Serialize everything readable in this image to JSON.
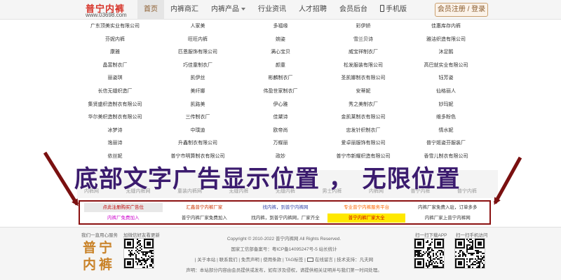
{
  "header": {
    "logo_text": "普宁内裤",
    "logo_url": "www.03698.com",
    "nav": [
      {
        "label": "首页",
        "active": true,
        "dropdown": false
      },
      {
        "label": "内裤商汇",
        "active": false,
        "dropdown": false
      },
      {
        "label": "内裤产品",
        "active": false,
        "dropdown": true
      },
      {
        "label": "行业资讯",
        "active": false,
        "dropdown": false
      },
      {
        "label": "人才招聘",
        "active": false,
        "dropdown": false
      },
      {
        "label": "会员后台",
        "active": false,
        "dropdown": false
      },
      {
        "label": "手机版",
        "active": false,
        "dropdown": false
      }
    ],
    "login_label": "会员注册 / 登录"
  },
  "companies": [
    "广东顶美实业有限公司",
    "人家美",
    "多福缘",
    "彩伊娇",
    "佳惠库存内裤",
    "芬妮内裤",
    "旺旺内裤",
    "婉姿",
    "雪兰贝诗",
    "雅洁织造有限公司",
    "康雅",
    "匹恩服饰有限公司",
    "满心宝贝",
    "威宝祥制衣厂",
    "沐足鹅",
    "晶富制衣厂",
    "巧佳童制衣厂",
    "颜童",
    "松发服装有限公司",
    "高巴就实业有限公司",
    "丽姿琪",
    "凯伊丝",
    "彬麟制衣厂",
    "圣凯娜制衣有限公司",
    "钰芳姿",
    "长信无缝织造厂",
    "美纤娜",
    "伟盈世家制衣厂",
    "安蒂妮",
    "仙格丽人",
    "集贤盛织造制衣有限公司",
    "凯路美",
    "伊心雅",
    "秀之美制衣厂",
    "妙玛妮",
    "华尔美织造制衣有限公司",
    "三传制衣厂",
    "佳黛诗",
    "金凯莱制衣有限公司",
    "维多粉色",
    "冰梦诗",
    "中璞迪",
    "欧帝尚",
    "忠发针织制衣厂",
    "情水妮",
    "逸丽诗",
    "升鑫制衣有限公司",
    "万蝶丽",
    "爱卓丽服饰有限公司",
    "普宁姬姿芬服装厂",
    "依丝妮",
    "普宁市明算制衣有限公司",
    "政妙",
    "普宁市新耀织造有限公司",
    "香雪儿制衣有限公司"
  ],
  "faint_row": [
    "内裤网",
    "无缝内裤网",
    "童装内裤网",
    "无缝内裤",
    "无缝内裤",
    "男士内裤",
    "内裤网",
    "普宁内裤",
    "普宁内裤"
  ],
  "overlay_text": "底部文字广告显示位置 ， 无限位置",
  "ad_rows": [
    [
      {
        "text": "点此注册购买广告位",
        "color": "#c00000",
        "bg": "#e8e8e8"
      },
      {
        "text": "汇鑫普宁内裤厂家",
        "color": "#cc3300",
        "bg": ""
      },
      {
        "text": "找内裤，到普宁内裤网",
        "color": "#3344aa",
        "bg": ""
      },
      {
        "text": "专业普宁内裤服务平台",
        "color": "#ff6600",
        "bg": ""
      },
      {
        "text": "内裤厂家免费入驻，订单多多",
        "color": "#333333",
        "bg": ""
      }
    ],
    [
      {
        "text": "内裤厂免费加入",
        "color": "#cc00cc",
        "bg": ""
      },
      {
        "text": "普宁内裤厂家免费加入",
        "color": "#333333",
        "bg": ""
      },
      {
        "text": "找内裤，到普宁内裤网，厂家齐全",
        "color": "#333333",
        "bg": ""
      },
      {
        "text": "普宁内裤厂家大全",
        "color": "#cc0000",
        "bg": "#ffe800"
      },
      {
        "text": "内裤厂家上普宁内裤网",
        "color": "#333333",
        "bg": ""
      }
    ]
  ],
  "footer": {
    "left_label_1": "我们一直用心服务",
    "left_label_2": "加微信好友看更新",
    "logo_line1": "普宁",
    "logo_line2": "内裤",
    "copyright": "Copyright © 2010-2022  普宁内裤网 All Rights Reserved.",
    "icp": "国家工信部备案号：粤ICP备14095247号-5    站长统计",
    "links_before": "| 关于本站 | 联系我们 | 免责声明 | 使用条款 | TAG标签 |",
    "links_after": "在线留言 | 技术支持：凡夫网",
    "disclaimer": "声明：本站部分内容由会员提供或发布，如有涉及侵权，请提供相关证明并与我们第一时间处理。",
    "right_label_1": "扫一扫下载APP",
    "right_label_2": "扫一扫手机访问"
  }
}
